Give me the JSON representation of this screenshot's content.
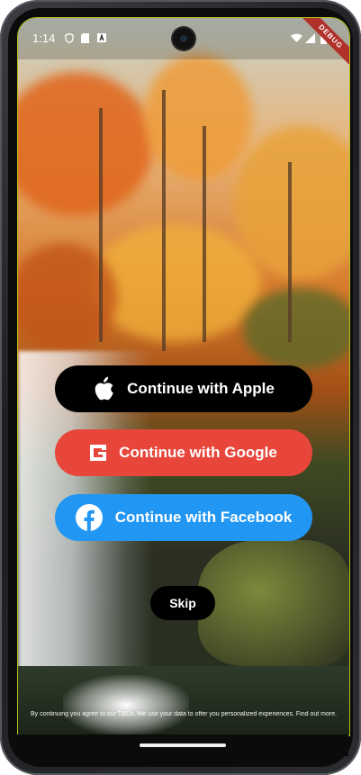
{
  "status_bar": {
    "time": "1:14",
    "debug_banner": "DEBUG",
    "left_icons": [
      "shield-icon",
      "sim-card-icon",
      "a-icon"
    ],
    "right_icons": [
      "wifi-icon",
      "signal-icon",
      "battery-icon"
    ]
  },
  "auth": {
    "apple_label": "Continue with Apple",
    "google_label": "Continue with Google",
    "facebook_label": "Continue with Facebook",
    "apple_color": "#000000",
    "google_color": "#e8463b",
    "facebook_color": "#2196f3"
  },
  "skip_label": "Skip",
  "terms_text": "By continuing you agree to our T&Cs. We use your data to offer you personalized experiences. Find out more."
}
